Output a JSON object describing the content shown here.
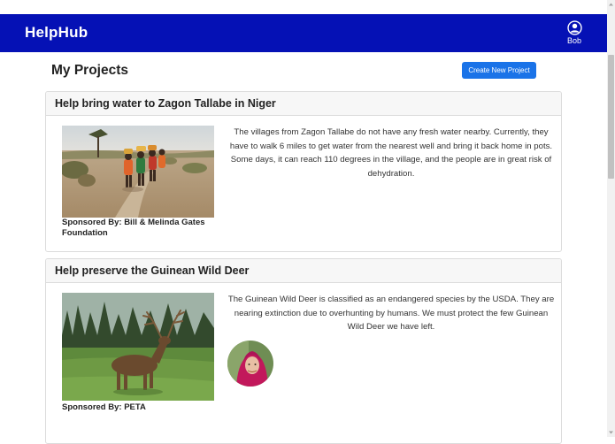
{
  "app": {
    "brand": "HelpHub"
  },
  "user": {
    "name": "Bob",
    "icon": "user-circle-icon"
  },
  "page": {
    "title": "My Projects",
    "create_button_label": "Create New Project"
  },
  "projects": [
    {
      "title": "Help bring water to Zagon Tallabe in Niger",
      "description": "The villages from Zagon Tallabe do not have any fresh water nearby. Currently, they have to walk 6 miles to get water from the nearest well and bring it back home in pots. Some days, it can reach 110 degrees in the village, and the people are in great risk of dehydration.",
      "sponsor": "Sponsored By: Bill & Melinda Gates Foundation",
      "image": "children-carrying-water-photo"
    },
    {
      "title": "Help preserve the Guinean Wild Deer",
      "description": "The Guinean Wild Deer is classified as an endangered species by the USDA. They are nearing extinction due to overhunting by humans. We must protect the few Guinean Wild Deer we have left.",
      "sponsor": "Sponsored By: PETA",
      "image": "wild-deer-photo",
      "member_avatar": "member-avatar-photo"
    }
  ],
  "colors": {
    "navbar": "#0511b5",
    "button": "#1a73e8",
    "card_header": "#f7f7f7"
  }
}
